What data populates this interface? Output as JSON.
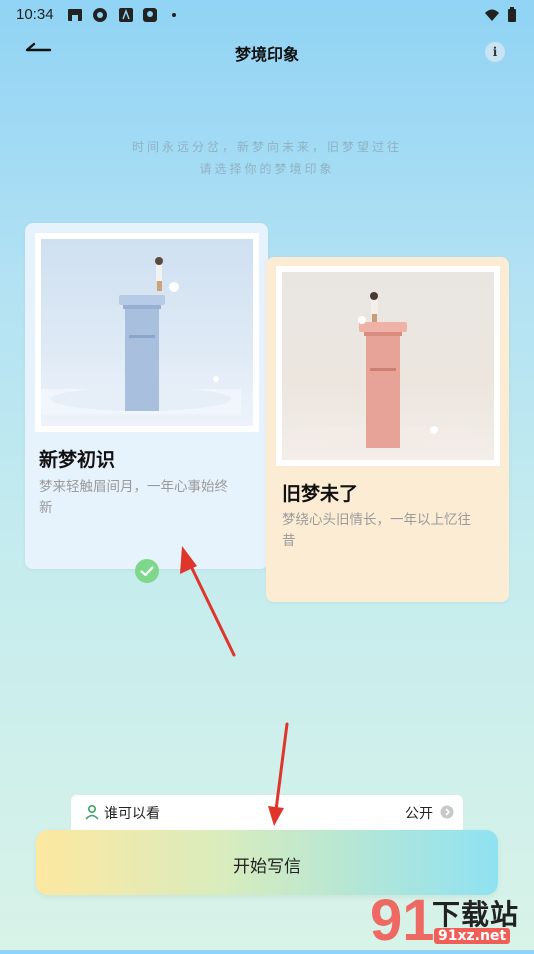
{
  "status_bar": {
    "time": "10:34"
  },
  "header": {
    "title": "梦境印象"
  },
  "subtitle": {
    "line1": "时间永远分岔，新梦向未来，旧梦望过往",
    "line2": "请选择你的梦境印象"
  },
  "cards": [
    {
      "title": "新梦初识",
      "desc_line1": "梦来轻触眉间月，一年心事始终",
      "desc_line2": "新",
      "selected": true
    },
    {
      "title": "旧梦未了",
      "desc_line1": "梦绕心头旧情长，一年以上忆往",
      "desc_line2": "昔",
      "selected": false
    }
  ],
  "visibility": {
    "label": "谁可以看",
    "value": "公开"
  },
  "start_button": {
    "label": "开始写信"
  },
  "watermark": {
    "brand": "下载站",
    "domain": "91xz.net"
  },
  "colors": {
    "arrow": "#e0352b",
    "check": "#7ed88c",
    "accent_from": "#fde8a0",
    "accent_to": "#8fe2f2"
  }
}
